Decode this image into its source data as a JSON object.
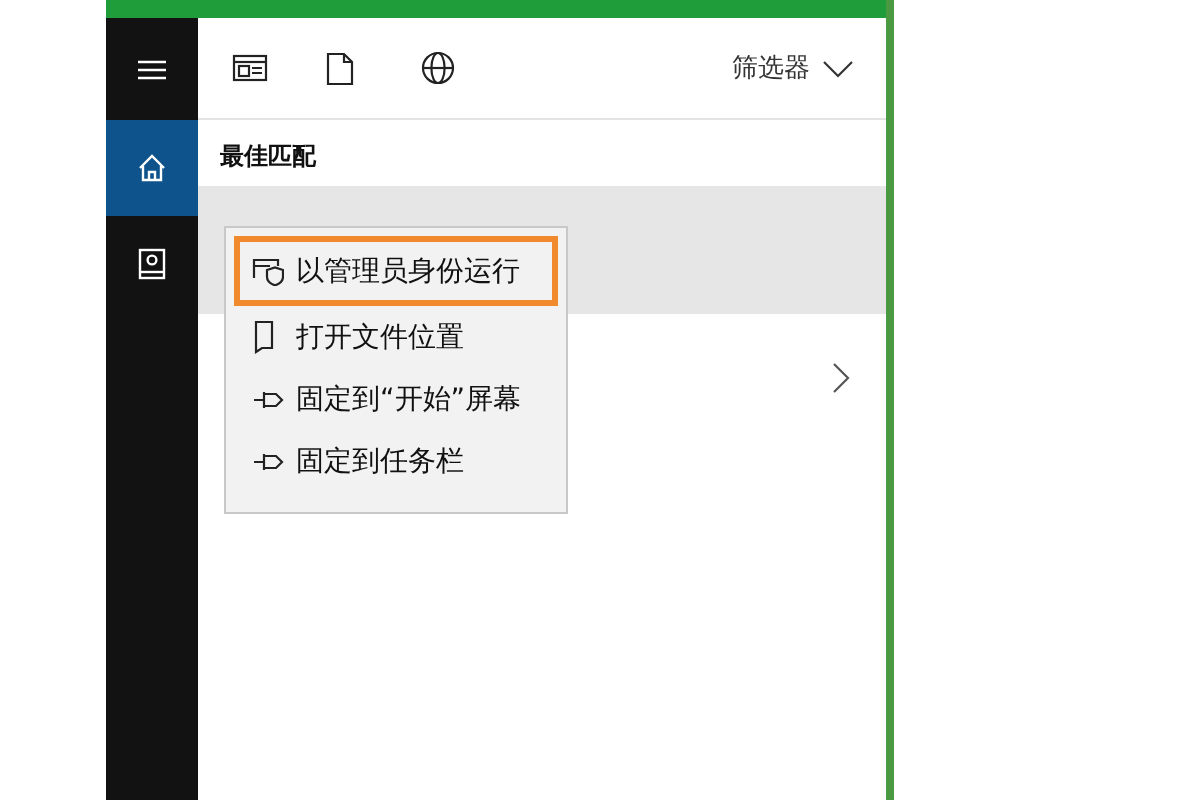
{
  "sidebar": {
    "items": [
      {
        "kind": "menu",
        "selected": false
      },
      {
        "kind": "home",
        "selected": true
      },
      {
        "kind": "contact",
        "selected": false
      }
    ]
  },
  "toolbar": {
    "filters": [
      {
        "kind": "apps"
      },
      {
        "kind": "documents"
      },
      {
        "kind": "web"
      }
    ],
    "filter_menu": "筛选器"
  },
  "best_match": {
    "heading": "最佳匹配"
  },
  "results": [
    {
      "selected": true
    },
    {
      "selected": false,
      "expandable": true
    }
  ],
  "context_menu": {
    "items": [
      {
        "kind": "admin",
        "label": "以管理员身份运行",
        "highlighted": true
      },
      {
        "kind": "folder",
        "label": "打开文件位置",
        "highlighted": false
      },
      {
        "kind": "pin",
        "label": "固定到“开始”屏幕",
        "highlighted": false
      },
      {
        "kind": "pin",
        "label": "固定到任务栏",
        "highlighted": false
      }
    ]
  }
}
